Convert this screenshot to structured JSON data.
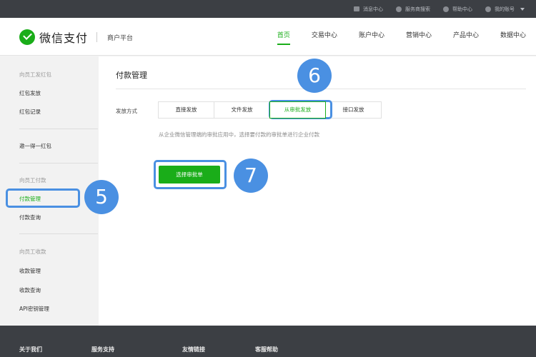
{
  "topbar": {
    "links": [
      "消息中心",
      "服务商搜索",
      "帮助中心",
      "我的账号"
    ]
  },
  "header": {
    "logo_text": "微信支付",
    "logo_sub": "商户平台",
    "nav": [
      "首页",
      "交易中心",
      "账户中心",
      "营销中心",
      "产品中心",
      "数据中心"
    ]
  },
  "sidebar": {
    "group1": "向员工发红包",
    "item_hb_send": "红包发放",
    "item_hb_record": "红包记录",
    "item_invite": "邀一得一红包",
    "group2": "向员工付款",
    "item_pay_manage": "付款管理",
    "item_pay_query": "付款查询",
    "group3": "向员工收款",
    "item_collect_manage": "收款管理",
    "item_collect_query": "收款查询",
    "item_api_key": "API密钥管理"
  },
  "main": {
    "title": "付款管理",
    "row_label": "发放方式",
    "tabs": [
      "直接发放",
      "文件发放",
      "从审批发放",
      "接口发放"
    ],
    "description": "从企业微信管理端的审批应用中，选择要付款的审批单进行企业付款",
    "select_button": "选择审批单"
  },
  "annotations": [
    "5",
    "6",
    "7"
  ],
  "footer": {
    "links": [
      "关于我们",
      "服务支持",
      "友情链接",
      "客服帮助"
    ]
  },
  "colors": {
    "brand_green": "#1aad19",
    "highlight_blue": "#4a90e2",
    "dark_bar": "#3c3f44"
  }
}
